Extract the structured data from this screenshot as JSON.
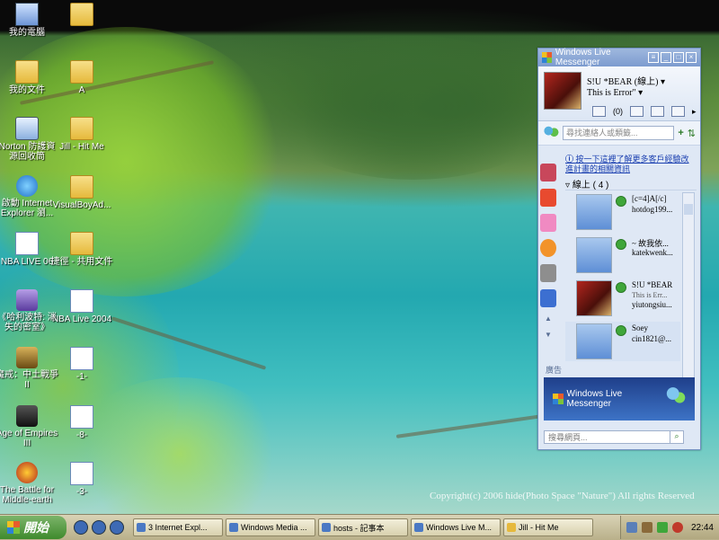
{
  "desktop": {
    "icons": [
      {
        "label": "我的電腦"
      },
      {
        "label": ""
      },
      {
        "label": "我的文件"
      },
      {
        "label": "A"
      },
      {
        "label": "Norton 防護資源回收筒"
      },
      {
        "label": "Jill - Hit Me"
      },
      {
        "label": "啟動 Internet Explorer 瀏..."
      },
      {
        "label": "VisualBoyAd..."
      },
      {
        "label": "NBA LIVE 06"
      },
      {
        "label": "捷徑 - 共用文件"
      },
      {
        "label": "《哈利波特: 消失的密室》"
      },
      {
        "label": "NBA Live 2004"
      },
      {
        "label": "魔戒：中土戰爭II"
      },
      {
        "label": "-1-"
      },
      {
        "label": "Age of Empires III"
      },
      {
        "label": "-8-"
      },
      {
        "label": "The Battle for Middle-earth"
      },
      {
        "label": "-3-"
      }
    ],
    "copyright": "Copyright(c) 2006 hide(Photo Space \"Nature\") All rights Reserved"
  },
  "messenger": {
    "title": "Windows Live Messenger",
    "profile": {
      "name": "S!U *BEAR (線上)",
      "personal_message": "This is Error\"",
      "mail_count": "(0)"
    },
    "search_placeholder": "尋找連絡人或類籤...",
    "info_link": "按一下這裡了解更多客戶經驗改進計畫的相關資訊",
    "group": "線上 ( 4 )",
    "contacts": [
      {
        "name": "[c=4]A[/c]",
        "msg": "",
        "id": "hotdog199..."
      },
      {
        "name": "~ 故我依...",
        "msg": "",
        "id": "katekwenk..."
      },
      {
        "name": "S!U *BEAR",
        "msg": "This is Err...",
        "id": "yiutongsiu..."
      },
      {
        "name": "Soey",
        "msg": "",
        "id": "cin1821@..."
      }
    ],
    "ad_label": "廣告",
    "ad_banner": "Windows Live Messenger",
    "web_search_placeholder": "搜尋網頁..."
  },
  "taskbar": {
    "start_label": "開始",
    "tasks": [
      {
        "label": "3 Internet Expl..."
      },
      {
        "label": "Windows Media ..."
      },
      {
        "label": "hosts - 記事本"
      },
      {
        "label": "Windows Live M..."
      },
      {
        "label": "Jill - Hit Me"
      }
    ],
    "clock": "22:44"
  }
}
